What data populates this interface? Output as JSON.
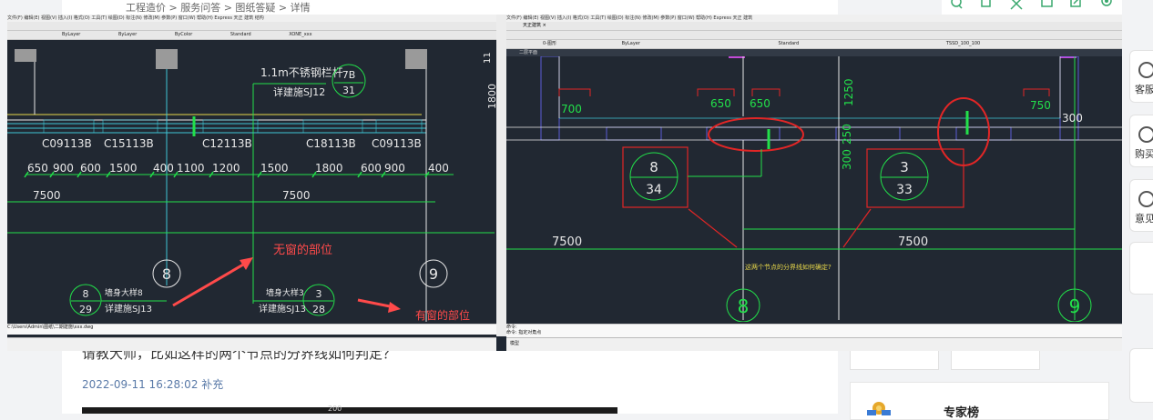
{
  "breadcrumb": "工程造价 > 服务问答 > 图纸答疑 > 详情",
  "post": {
    "question": "请教大师，比如这样的两个节点的分界线如何判定？",
    "time": "2022-09-11 16:28:02 补充",
    "image_label": "200"
  },
  "sidebar": {
    "expert_title": "专家榜",
    "buttons": [
      {
        "label": "客服"
      },
      {
        "label": "购买"
      },
      {
        "label": "意见"
      }
    ]
  },
  "top_tools": [
    "zoom-icon",
    "copy-icon",
    "crop-icon",
    "save-icon",
    "share-icon",
    "settings-icon"
  ],
  "cad_left": {
    "menu": "文件(F)  编辑(E)  视图(V)  插入(I)  格式(O)  工具(T)  绘图(D)  标注(N)  修改(M)  参数(P)  窗口(W)  帮助(H)  Express  天正  建筑  结构",
    "layer_select": "0",
    "linetype": "ByLayer",
    "lineweight": "ByLayer",
    "color": "ByColor",
    "textstyle": "Standard",
    "dimstyle": "XONE_xxx",
    "railing_label": "1.1m不锈钢栏杆",
    "railing_ref": "详建施SJ12",
    "bubble_top": {
      "num": "7B",
      "sheet": "31"
    },
    "windows": [
      "C09113B",
      "C15113B",
      "C12113B",
      "C18113B",
      "C09113B"
    ],
    "dims": [
      "650",
      "900",
      "600",
      "1500",
      "400",
      "1100",
      "1200",
      "1500",
      "1800",
      "600",
      "900",
      "400"
    ],
    "dim_left": "7500",
    "dim_right": "7500",
    "axis_8": "8",
    "axis_9": "9",
    "detail1": {
      "num": "8",
      "sheet": "29",
      "text1": "墙身大样8",
      "text2": "详建施SJ13"
    },
    "detail2": {
      "num": "3",
      "sheet": "28",
      "text1": "墙身大样3",
      "text2": "详建施SJ13"
    },
    "annot_no_window": "无窗的部位",
    "annot_window": "有窗的部位",
    "side_dim": "11",
    "side_dim2": "1800",
    "status": "C:\\Users\\Admin\\图纸\\二期建施\\xxx.dwg"
  },
  "cad_right": {
    "tab": "天正建筑 ×",
    "menu": "文件(F)  编辑(E)  视图(V)  插入(I)  格式(O)  工具(T)  绘图(D)  标注(N)  修改(M)  参数(P)  窗口(W)  帮助(H)  Express  天正  建筑",
    "layer": "0-图形",
    "linetype": "ByLayer",
    "textstyle": "Standard",
    "dimstyle": "TSSD_100_100",
    "model_tab": "二层平面",
    "dims_top": [
      "700",
      "650",
      "650",
      "750"
    ],
    "dim_1250": "1250",
    "dim_250": "250",
    "dim_300a": "300",
    "dim_300b": "300",
    "bubble1": {
      "num": "8",
      "sheet": "34"
    },
    "bubble2": {
      "num": "3",
      "sheet": "33"
    },
    "dim_7500a": "7500",
    "dim_7500b": "7500",
    "axis_8": "8",
    "axis_9": "9",
    "question_note": "这两个节点的分界线如何确定?",
    "cmd1": "命令:",
    "cmd2": "命令: 指定对角点",
    "model": "模型"
  },
  "colors": {
    "cad_bg": "#212832",
    "cyan": "#3fc6d6",
    "green": "#22e04a",
    "white": "#e8e8e8",
    "red": "#e22626",
    "yellow": "#e8d84a"
  }
}
